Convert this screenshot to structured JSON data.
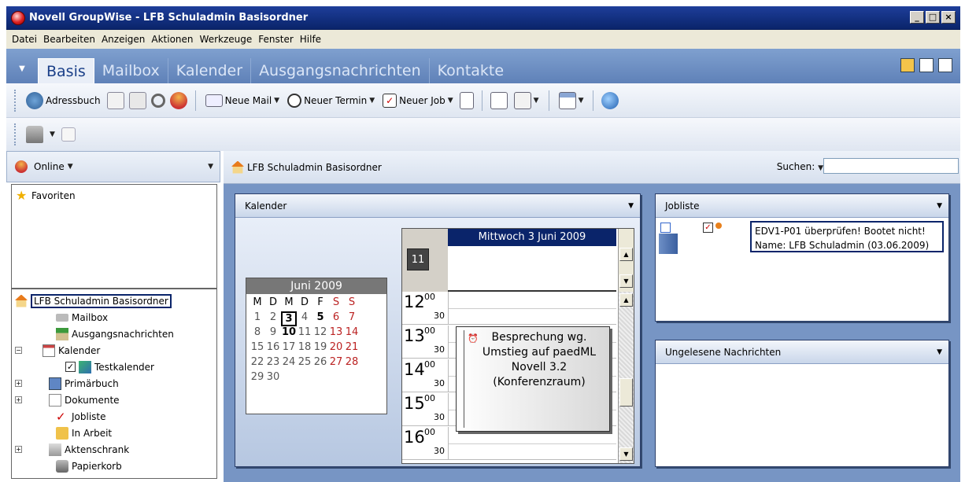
{
  "window": {
    "title": "Novell GroupWise - LFB Schuladmin Basisordner",
    "buttons": [
      "_",
      "□",
      "×"
    ]
  },
  "menu": [
    "Datei",
    "Bearbeiten",
    "Anzeigen",
    "Aktionen",
    "Werkzeuge",
    "Fenster",
    "Hilfe"
  ],
  "tabs": [
    {
      "label": "Basis",
      "active": true
    },
    {
      "label": "Mailbox"
    },
    {
      "label": "Kalender"
    },
    {
      "label": "Ausgangsnachrichten"
    },
    {
      "label": "Kontakte"
    }
  ],
  "toolbar": {
    "address_book": "Adressbuch",
    "new_mail": "Neue Mail",
    "new_appointment": "Neuer Termin",
    "new_task": "Neuer Job"
  },
  "left": {
    "online": "Online",
    "favorites": "Favoriten",
    "tree": [
      {
        "label": "LFB Schuladmin Basisordner",
        "level": 0
      },
      {
        "label": "Mailbox",
        "level": 1
      },
      {
        "label": "Ausgangsnachrichten",
        "level": 1
      },
      {
        "label": "Kalender",
        "level": 1
      },
      {
        "label": "Testkalender",
        "level": 2
      },
      {
        "label": "Primärbuch",
        "level": 1
      },
      {
        "label": "Dokumente",
        "level": 1
      },
      {
        "label": "Jobliste",
        "level": 1
      },
      {
        "label": "In Arbeit",
        "level": 1
      },
      {
        "label": "Aktenschrank",
        "level": 1
      },
      {
        "label": "Papierkorb",
        "level": 1
      }
    ]
  },
  "path": "LFB Schuladmin Basisordner",
  "search_label": "Suchen:",
  "calendar": {
    "panel_title": "Kalender",
    "month_title": "Juni 2009",
    "weekdays": [
      "M",
      "D",
      "M",
      "D",
      "F",
      "S",
      "S"
    ],
    "weeks": [
      [
        "1",
        "2",
        "3",
        "4",
        "5",
        "6",
        "7"
      ],
      [
        "8",
        "9",
        "10",
        "11",
        "12",
        "13",
        "14"
      ],
      [
        "15",
        "16",
        "17",
        "18",
        "19",
        "20",
        "21"
      ],
      [
        "22",
        "23",
        "24",
        "25",
        "26",
        "27",
        "28"
      ],
      [
        "29",
        "30",
        "",
        "",
        "",
        "",
        ""
      ]
    ],
    "day_title": "Mittwoch 3 Juni 2009",
    "hours": [
      "12",
      "13",
      "14",
      "15",
      "16"
    ],
    "minute_labels": [
      "00",
      "30"
    ],
    "appointment": "Besprechung wg. Umstieg auf paedML Novell 3.2 (Konferenzraum)",
    "toggle_label": "11"
  },
  "tasks": {
    "panel_title": "Jobliste",
    "line1": "EDV1-P01 überprüfen! Bootet nicht!",
    "line2": "Name: LFB Schuladmin (03.06.2009)"
  },
  "messages": {
    "panel_title": "Ungelesene Nachrichten"
  },
  "colors": {
    "titlebar": "#0a246a",
    "tabbar": "#6f90c4",
    "workspace": "#7795c4"
  }
}
